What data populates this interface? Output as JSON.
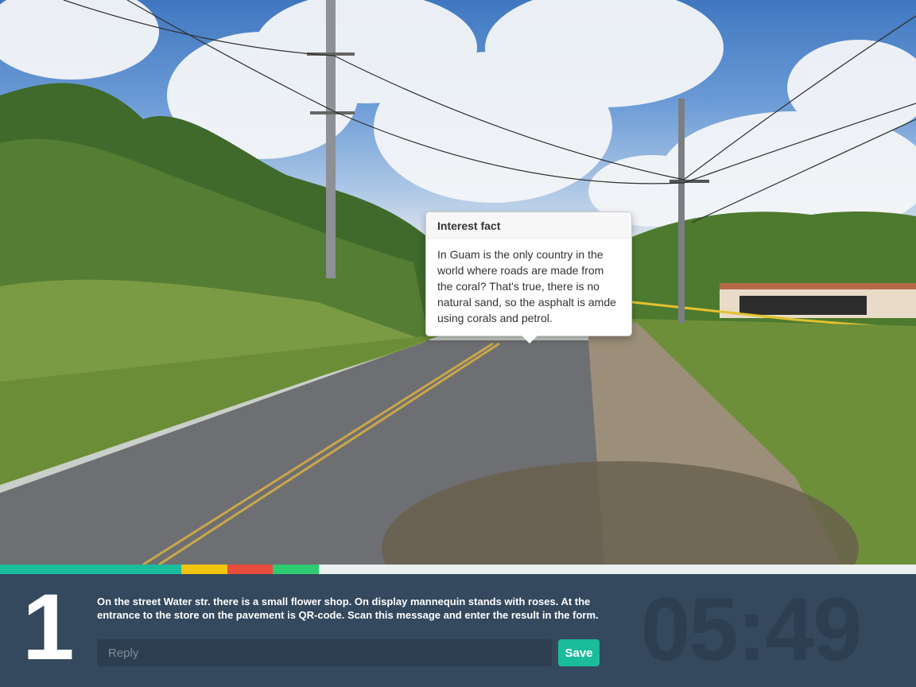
{
  "popover": {
    "title": "Interest fact",
    "content": "In Guam is the only country in the world where roads are made from the coral? That's true, there is no natural sand, so the asphalt is amde using corals and petrol."
  },
  "progress": {
    "segments": [
      {
        "color": "#1abc9c",
        "fraction": 0.198
      },
      {
        "color": "#f1c40f",
        "fraction": 0.05
      },
      {
        "color": "#e74c3c",
        "fraction": 0.05
      },
      {
        "color": "#2ecc71",
        "fraction": 0.05
      }
    ],
    "track_color": "#ecf0f1"
  },
  "task": {
    "step": "1",
    "text": "On the street Water str. there is a small flower shop. On display mannequin stands with roses. At the entrance to the store on the pavement is QR-code. Scan this message and enter the result in the form.",
    "reply_placeholder": "Reply",
    "save_label": "Save",
    "timer": "05:49"
  }
}
